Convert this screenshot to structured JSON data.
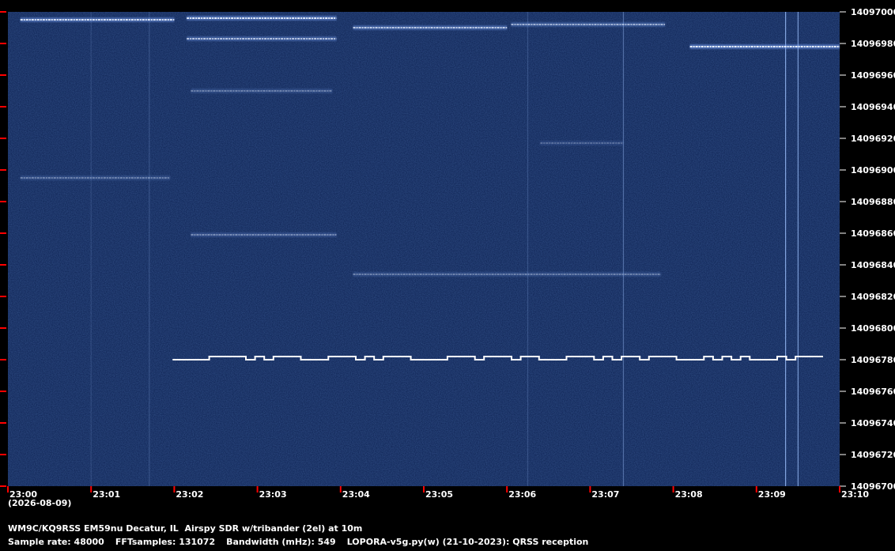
{
  "chart_data": {
    "type": "heatmap",
    "xlabel": "",
    "ylabel": "",
    "x_ticks": [
      "23:00",
      "23:01",
      "23:02",
      "23:03",
      "23:04",
      "23:05",
      "23:06",
      "23:07",
      "23:08",
      "23:09",
      "23:10"
    ],
    "x_date_label": "(2026-08-09)",
    "y_ticks": [
      14097000,
      14096980,
      14096960,
      14096940,
      14096920,
      14096900,
      14096880,
      14096860,
      14096840,
      14096820,
      14096800,
      14096780,
      14096760,
      14096740,
      14096720,
      14096700
    ],
    "ylim": [
      14096700,
      14097000
    ],
    "x_range_minutes": [
      0,
      10
    ],
    "signal_trace": {
      "name": "",
      "start_minute": 1.98,
      "end_minute": 9.8,
      "freq_low": 14096780,
      "freq_high": 14096782,
      "bits": [
        0,
        0,
        0,
        0,
        1,
        1,
        1,
        1,
        0,
        1,
        0,
        1,
        1,
        1,
        0,
        0,
        0,
        1,
        1,
        1,
        0,
        1,
        0,
        1,
        1,
        1,
        0,
        0,
        0,
        0,
        1,
        1,
        1,
        0,
        1,
        1,
        1,
        0,
        1,
        1,
        0,
        0,
        0,
        1,
        1,
        1,
        0,
        1,
        0,
        1,
        1,
        0,
        1,
        1,
        1,
        0,
        0,
        0,
        1,
        0,
        1,
        0,
        1,
        0,
        0,
        0,
        1,
        0,
        1,
        1,
        1
      ]
    },
    "bright_bands": [
      {
        "start": 0.15,
        "end": 2.0,
        "freq": 14096995,
        "intensity": 0.9
      },
      {
        "start": 2.15,
        "end": 3.95,
        "freq": 14096996,
        "intensity": 0.95
      },
      {
        "start": 2.15,
        "end": 3.95,
        "freq": 14096983,
        "intensity": 0.7
      },
      {
        "start": 4.15,
        "end": 6.0,
        "freq": 14096990,
        "intensity": 0.75
      },
      {
        "start": 6.05,
        "end": 7.9,
        "freq": 14096992,
        "intensity": 0.6
      },
      {
        "start": 8.2,
        "end": 10.0,
        "freq": 14096978,
        "intensity": 1.0
      },
      {
        "start": 2.2,
        "end": 3.9,
        "freq": 14096950,
        "intensity": 0.35
      },
      {
        "start": 0.15,
        "end": 1.95,
        "freq": 14096895,
        "intensity": 0.35
      },
      {
        "start": 2.2,
        "end": 3.95,
        "freq": 14096859,
        "intensity": 0.4
      },
      {
        "start": 4.15,
        "end": 7.85,
        "freq": 14096834,
        "intensity": 0.35
      },
      {
        "start": 6.4,
        "end": 7.4,
        "freq": 14096917,
        "intensity": 0.25
      }
    ],
    "vertical_lines": [
      {
        "minute": 9.35,
        "intensity": 0.8
      },
      {
        "minute": 9.5,
        "intensity": 0.7
      },
      {
        "minute": 7.4,
        "intensity": 0.4
      },
      {
        "minute": 1.7,
        "intensity": 0.2
      },
      {
        "minute": 1.0,
        "intensity": 0.15
      },
      {
        "minute": 6.25,
        "intensity": 0.2
      }
    ]
  },
  "info": {
    "line1": "WM9C/KQ9RSS EM59nu Decatur, IL  Airspy SDR w/tribander (2el) at 10m",
    "sample_rate": "Sample rate: 48000",
    "fft_samples": "FFTsamples: 131072",
    "bandwidth": "Bandwidth (mHz): 549",
    "software": "LOPORA-v5g.py(w) (21-10-2023): QRSS reception"
  },
  "colors": {
    "background": "#000000",
    "waterfall_base": "#0b1f4f",
    "signal": "#ffffff",
    "tick": "#ff0000"
  }
}
